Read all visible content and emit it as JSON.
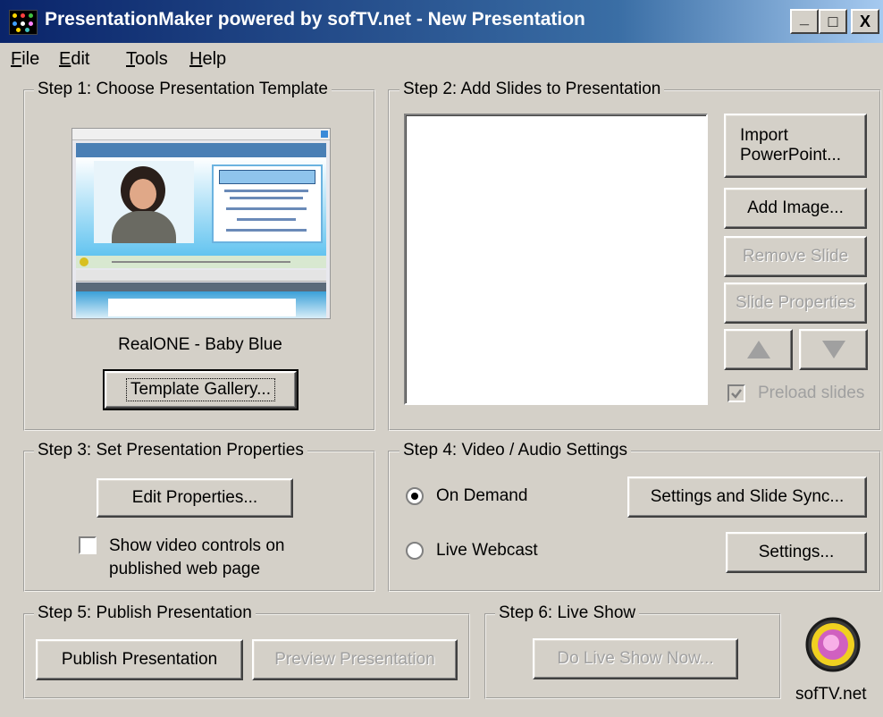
{
  "window": {
    "title": "PresentationMaker powered by sofTV.net - New Presentation",
    "buttons": {
      "minimize": "_",
      "maximize": "□",
      "close": "X"
    }
  },
  "menu": {
    "items": [
      {
        "label": "File",
        "mnemonic_index": 0
      },
      {
        "label": "Edit",
        "mnemonic_index": 0
      },
      {
        "label": "Tools",
        "mnemonic_index": 0
      },
      {
        "label": "Help",
        "mnemonic_index": 0
      }
    ]
  },
  "step1": {
    "legend": "Step 1: Choose Presentation Template",
    "template_name": "RealONE - Baby Blue",
    "gallery_button": "Template Gallery..."
  },
  "step2": {
    "legend": "Step 2: Add Slides to Presentation",
    "import_button_line1": "Import",
    "import_button_line2": "PowerPoint...",
    "add_image_button": "Add Image...",
    "remove_slide_button": "Remove Slide",
    "slide_properties_button": "Slide Properties",
    "preload_label": "Preload slides",
    "preload_checked": true
  },
  "step3": {
    "legend": "Step 3: Set Presentation Properties",
    "edit_properties_button": "Edit Properties...",
    "show_controls_line1": "Show video controls on",
    "show_controls_line2": "published web page",
    "show_controls_checked": false
  },
  "step4": {
    "legend": "Step 4: Video / Audio Settings",
    "on_demand_label": "On Demand",
    "on_demand_selected": true,
    "live_webcast_label": "Live Webcast",
    "settings_sync_button": "Settings and Slide Sync...",
    "settings_button": "Settings..."
  },
  "step5": {
    "legend": "Step 5: Publish Presentation",
    "publish_button": "Publish Presentation",
    "preview_button": "Preview Presentation"
  },
  "step6": {
    "legend": "Step 6: Live Show",
    "live_show_button": "Do Live Show Now..."
  },
  "brand": {
    "label": "sofTV.net"
  },
  "colors": {
    "titlebar_start": "#0a246a",
    "titlebar_end": "#a6caf0",
    "face": "#d4d0c8",
    "disabled_text": "#a0a0a0"
  }
}
